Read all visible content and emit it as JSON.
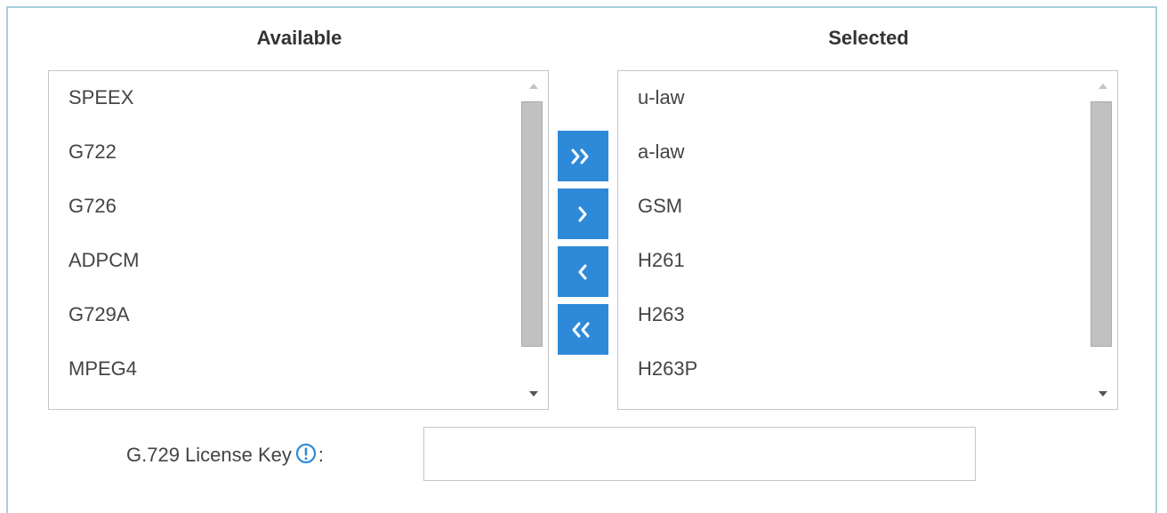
{
  "available": {
    "heading": "Available",
    "items": [
      "SPEEX",
      "G722",
      "G726",
      "ADPCM",
      "G729A",
      "MPEG4"
    ]
  },
  "selected": {
    "heading": "Selected",
    "items": [
      "u-law",
      "a-law",
      "GSM",
      "H261",
      "H263",
      "H263P"
    ]
  },
  "buttons": {
    "move_all_right": "double-chevron-right-icon",
    "move_right": "chevron-right-icon",
    "move_left": "chevron-left-icon",
    "move_all_left": "double-chevron-left-icon",
    "color": "#2e8ad8"
  },
  "license": {
    "label": "G.729 License Key",
    "colon": ":",
    "value": "",
    "info_icon": "info-icon",
    "info_color": "#2e8ad8"
  }
}
